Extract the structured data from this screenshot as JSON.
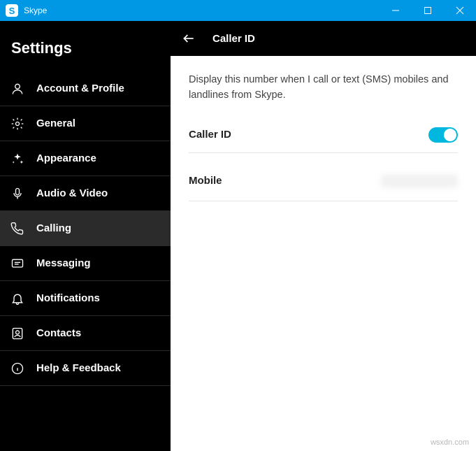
{
  "window": {
    "app_letter": "S",
    "title": "Skype"
  },
  "sidebar": {
    "title": "Settings",
    "items": [
      {
        "id": "account-profile",
        "label": "Account & Profile",
        "icon": "person-icon"
      },
      {
        "id": "general",
        "label": "General",
        "icon": "gear-icon"
      },
      {
        "id": "appearance",
        "label": "Appearance",
        "icon": "sparkle-icon"
      },
      {
        "id": "audio-video",
        "label": "Audio & Video",
        "icon": "mic-icon"
      },
      {
        "id": "calling",
        "label": "Calling",
        "icon": "phone-icon",
        "active": true
      },
      {
        "id": "messaging",
        "label": "Messaging",
        "icon": "message-icon"
      },
      {
        "id": "notifications",
        "label": "Notifications",
        "icon": "bell-icon"
      },
      {
        "id": "contacts",
        "label": "Contacts",
        "icon": "contacts-icon"
      },
      {
        "id": "help-feedback",
        "label": "Help & Feedback",
        "icon": "info-icon"
      }
    ]
  },
  "main": {
    "header_title": "Caller ID",
    "description": "Display this number when I call or text (SMS) mobiles and landlines from Skype.",
    "caller_id_label": "Caller ID",
    "caller_id_on": true,
    "mobile_label": "Mobile",
    "mobile_value": ""
  },
  "watermark": "wsxdn.com"
}
